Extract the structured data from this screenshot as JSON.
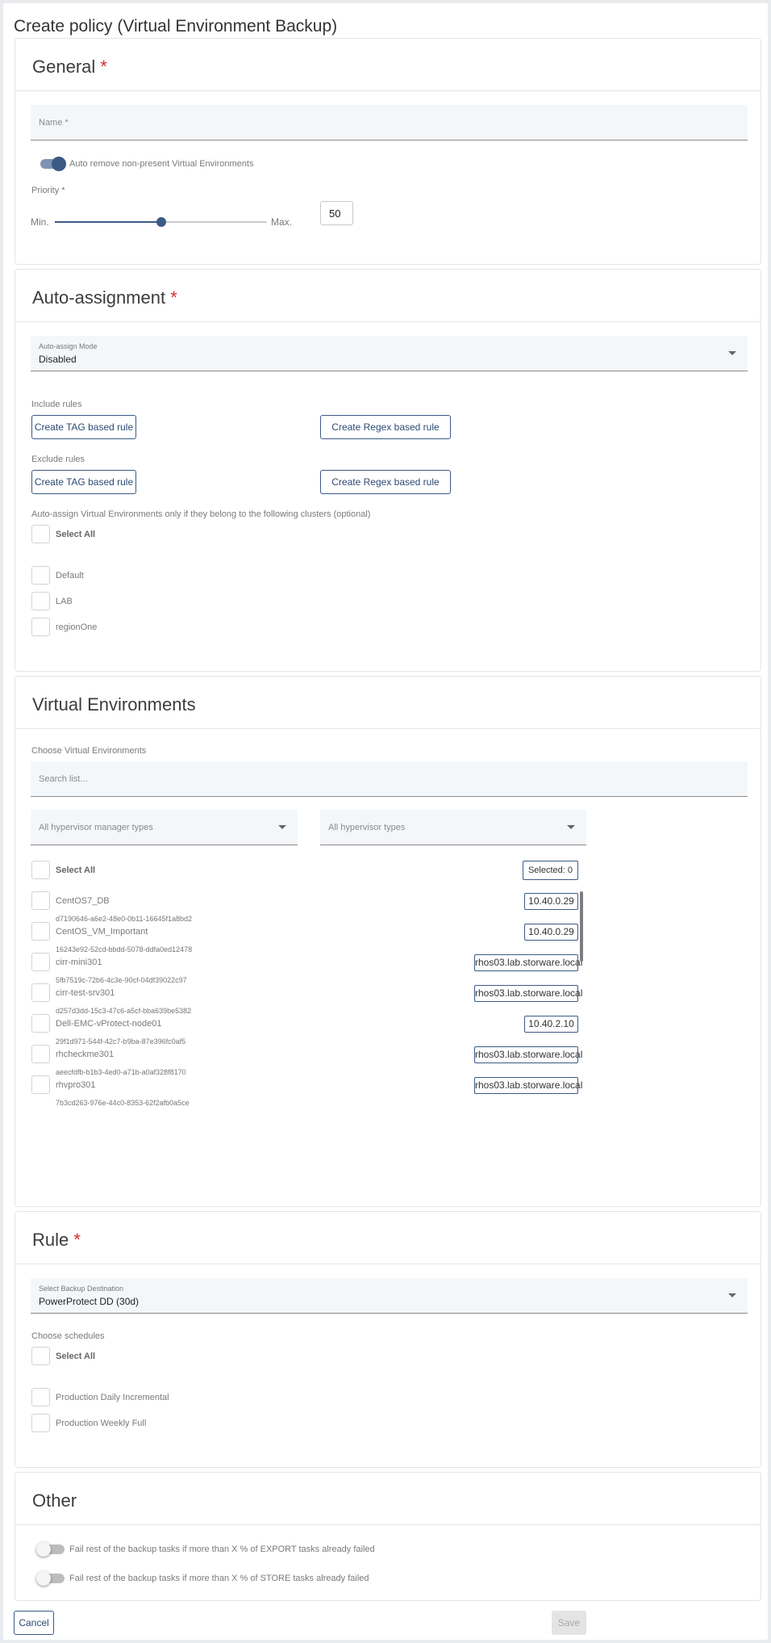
{
  "page": {
    "title": "Create policy (Virtual Environment Backup)"
  },
  "general": {
    "title": "General",
    "required_mark": "*",
    "name_placeholder": "Name *",
    "auto_remove_label": "Auto remove non-present Virtual Environments",
    "auto_remove_on": true,
    "priority_label": "Priority *",
    "priority_min": "Min.",
    "priority_max": "Max.",
    "priority_value": "50",
    "priority_fraction": 0.5
  },
  "auto_assignment": {
    "title": "Auto-assignment",
    "required_mark": "*",
    "mode_label": "Auto-assign Mode",
    "mode_value": "Disabled",
    "include_label": "Include rules",
    "exclude_label": "Exclude rules",
    "tag_rule_button": "Create TAG based rule",
    "regex_rule_button": "Create Regex based rule",
    "clusters_label": "Auto-assign Virtual Environments only if they belong to the following clusters (optional)",
    "select_all": "Select All",
    "clusters": [
      "Default",
      "LAB",
      "regionOne"
    ]
  },
  "virtual_environments": {
    "title": "Virtual Environments",
    "choose_label": "Choose Virtual Environments",
    "search_placeholder": "Search list...",
    "hypervisor_manager_types": "All hypervisor manager types",
    "hypervisor_types": "All hypervisor types",
    "select_all": "Select All",
    "selected_count": "Selected: 0",
    "items": [
      {
        "name": "CentOS7_DB",
        "uuid": "d7190646-a6e2-48e0-0b11-16645f1a8bd2",
        "host": "10.40.0.29"
      },
      {
        "name": "CentOS_VM_Important",
        "uuid": "16243e92-52cd-bbdd-5078-ddfa0ed12478",
        "host": "10.40.0.29"
      },
      {
        "name": "cirr-mini301",
        "uuid": "5fb7519c-72b6-4c3e-90cf-04df39022c97",
        "host": "rhos03.lab.storware.local"
      },
      {
        "name": "cirr-test-srv301",
        "uuid": "d257d3dd-15c3-47c6-a5cf-bba639be5382",
        "host": "rhos03.lab.storware.local"
      },
      {
        "name": "Dell-EMC-vProtect-node01",
        "uuid": "29f1d971-544f-42c7-b9ba-87e396fc0af5",
        "host": "10.40.2.10"
      },
      {
        "name": "rhcheckme301",
        "uuid": "aeecfdfb-b1b3-4ed0-a71b-a0af328f8170",
        "host": "rhos03.lab.storware.local"
      },
      {
        "name": "rhvpro301",
        "uuid": "7b3cd263-976e-44c0-8353-62f2afb0a5ce",
        "host": "rhos03.lab.storware.local"
      }
    ]
  },
  "rule": {
    "title": "Rule",
    "required_mark": "*",
    "destination_label": "Select Backup Destination",
    "destination_value": "PowerProtect DD (30d)",
    "schedules_label": "Choose schedules",
    "select_all": "Select All",
    "schedules": [
      "Production Daily Incremental",
      "Production Weekly Full"
    ]
  },
  "other": {
    "title": "Other",
    "export_fail_label": "Fail rest of the backup tasks if more than X % of EXPORT tasks already failed",
    "store_fail_label": "Fail rest of the backup tasks if more than X % of STORE tasks already failed"
  },
  "footer": {
    "cancel": "Cancel",
    "save": "Save"
  },
  "colors": {
    "accent": "#2d4a74",
    "required": "#d32f2f",
    "toggle_on": "#3b5a86"
  }
}
